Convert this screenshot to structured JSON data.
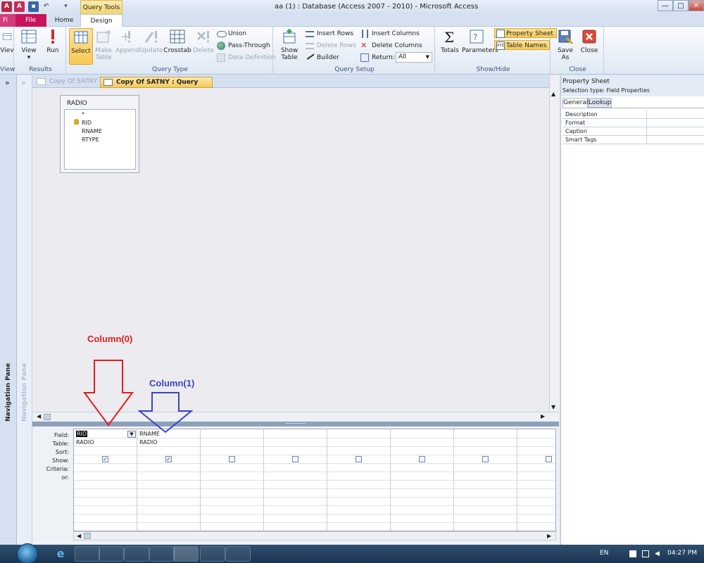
{
  "window": {
    "title": "aa (1) : Database (Access 2007 - 2010)  -  Microsoft Access",
    "context_tab": "Query Tools",
    "buttons": {
      "minimize": "—",
      "maximize": "□",
      "close": "✕"
    }
  },
  "tabs": {
    "file_short": "Fi",
    "file": "File",
    "home": "Home",
    "design": "Design"
  },
  "ribbon": {
    "results": {
      "label": "Results",
      "view_cut": "Viev",
      "view": "View",
      "run": "Run",
      "group_cut": "View"
    },
    "query_type": {
      "label": "Query Type",
      "select": "Select",
      "make_table": "Make Table",
      "append": "Append",
      "update": "Update",
      "crosstab": "Crosstab",
      "delete": "Delete",
      "union": "Union",
      "pass_through": "Pass-Through",
      "data_definition": "Data Definition"
    },
    "query_setup": {
      "label": "Query Setup",
      "show_table": "Show Table",
      "insert_rows": "Insert Rows",
      "delete_rows": "Delete Rows",
      "builder": "Builder",
      "insert_columns": "Insert Columns",
      "delete_columns": "Delete Columns",
      "return_label": "Return:",
      "return_value": "All"
    },
    "show_hide": {
      "label": "Show/Hide",
      "totals": "Totals",
      "parameters": "Parameters",
      "property_sheet": "Property Sheet",
      "table_names": "Table Names"
    },
    "close": {
      "label": "Close",
      "save_as": "Save As",
      "close": "Close"
    }
  },
  "nav": {
    "pane_label": "Navigation Pane",
    "expand": "»"
  },
  "doc_tabs": [
    "Copy Of SATNY",
    "Copy Of SATNY : Query Builder"
  ],
  "table_box": {
    "name": "RADIO",
    "fields": [
      "*",
      "RID",
      "RNAME",
      "RTYPE"
    ]
  },
  "grid": {
    "row_labels": [
      "Field:",
      "Table:",
      "Sort:",
      "Show:",
      "Criteria:",
      "or:"
    ],
    "columns": [
      {
        "field": "RID",
        "table": "RADIO",
        "show": true
      },
      {
        "field": "RNAME",
        "table": "RADIO",
        "show": true
      },
      {
        "field": "",
        "table": "",
        "show": false
      },
      {
        "field": "",
        "table": "",
        "show": false
      },
      {
        "field": "",
        "table": "",
        "show": false
      },
      {
        "field": "",
        "table": "",
        "show": false
      },
      {
        "field": "",
        "table": "",
        "show": false
      },
      {
        "field": "",
        "table": "",
        "show": false
      }
    ]
  },
  "property_sheet": {
    "title": "Property Sheet",
    "selection_type": "Selection type:  Field Properties",
    "tabs": [
      "General",
      "Lookup"
    ],
    "rows": [
      "Description",
      "Format",
      "Caption",
      "Smart Tags"
    ]
  },
  "annotations": {
    "col0": "Column(0)",
    "col1": "Column(1)",
    "col0_color": "#e51b1b",
    "col1_color": "#3a45c7"
  },
  "taskbar": {
    "lang": "EN",
    "time": "04:27 PM"
  }
}
